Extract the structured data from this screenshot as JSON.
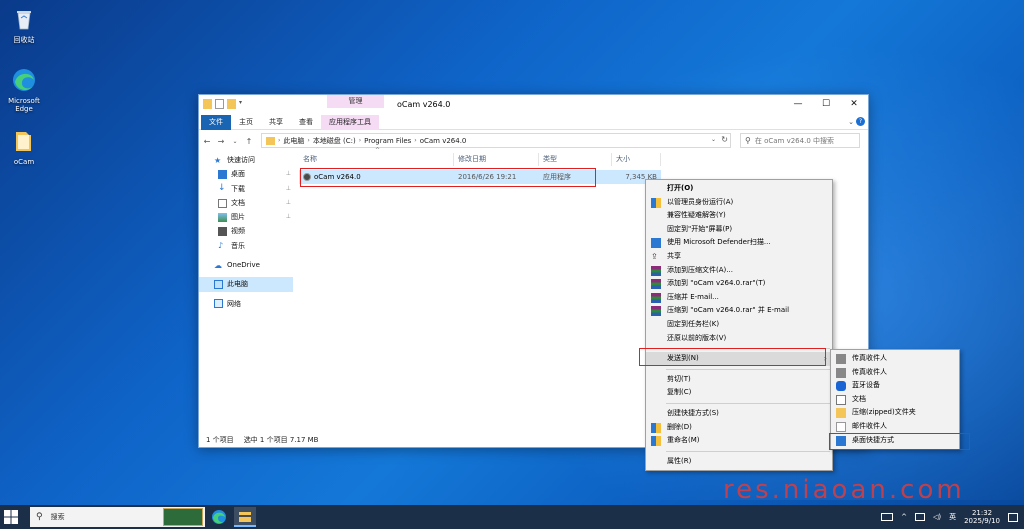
{
  "desktop": {
    "icons": [
      {
        "label": "回收站",
        "icon": "recycle-bin-icon"
      },
      {
        "label": "Microsoft Edge",
        "icon": "edge-icon"
      },
      {
        "label": "oCam",
        "icon": "folder-icon"
      }
    ]
  },
  "window": {
    "title": "oCam v264.0",
    "contextual_tab_group": "管理",
    "controls": {
      "minimize": "—",
      "maximize": "☐",
      "close": "✕"
    },
    "ribbon_tabs": [
      "文件",
      "主页",
      "共享",
      "查看",
      "应用程序工具"
    ],
    "ribbon_collapse": "⌄",
    "help": "?",
    "address": {
      "segments": [
        "此电脑",
        "本地磁盘 (C:)",
        "Program Files",
        "oCam v264.0"
      ],
      "separator": "›"
    },
    "search_placeholder": "在 oCam v264.0 中搜索",
    "nav_buttons": {
      "back": "←",
      "forward": "→",
      "dropdown": "⌄",
      "up": "↑"
    },
    "nav": [
      {
        "label": "快速访问",
        "icon": "star-icon",
        "pinned": false
      },
      {
        "label": "桌面",
        "icon": "desktop-icon",
        "pinned": true
      },
      {
        "label": "下载",
        "icon": "download-icon",
        "pinned": true
      },
      {
        "label": "文档",
        "icon": "document-icon",
        "pinned": true
      },
      {
        "label": "图片",
        "icon": "picture-icon",
        "pinned": true
      },
      {
        "label": "视频",
        "icon": "video-icon",
        "pinned": false
      },
      {
        "label": "音乐",
        "icon": "music-icon",
        "pinned": false
      },
      {
        "label": "OneDrive",
        "icon": "cloud-icon",
        "pinned": false
      },
      {
        "label": "此电脑",
        "icon": "computer-icon",
        "pinned": false,
        "selected": true
      },
      {
        "label": "网络",
        "icon": "network-icon",
        "pinned": false
      }
    ],
    "pin_glyph": "📌",
    "columns": [
      "名称",
      "修改日期",
      "类型",
      "大小"
    ],
    "files": [
      {
        "name": "oCam v264.0",
        "modified": "2016/6/26 19:21",
        "type": "应用程序",
        "size": "7,345 KB"
      }
    ],
    "status": {
      "count": "1 个项目",
      "selected": "选中 1 个项目  7.17 MB"
    }
  },
  "context_menu": {
    "items": [
      {
        "label": "打开(O)",
        "bold": true
      },
      {
        "label": "以管理员身份运行(A)",
        "icon": "shield-icon"
      },
      {
        "label": "兼容性疑难解答(Y)"
      },
      {
        "label": "固定到\"开始\"屏幕(P)"
      },
      {
        "label": "使用 Microsoft Defender扫描...",
        "icon": "defender-icon"
      },
      {
        "label": "共享",
        "icon": "share-icon"
      },
      {
        "label": "添加到压缩文件(A)...",
        "icon": "winrar-icon"
      },
      {
        "label": "添加到 \"oCam v264.0.rar\"(T)",
        "icon": "winrar-icon"
      },
      {
        "label": "压缩并 E-mail...",
        "icon": "winrar-icon"
      },
      {
        "label": "压缩到 \"oCam v264.0.rar\" 并 E-mail",
        "icon": "winrar-icon"
      },
      {
        "label": "固定到任务栏(K)"
      },
      {
        "label": "还原以前的版本(V)"
      },
      {
        "sep": true
      },
      {
        "label": "发送到(N)",
        "submenu": true,
        "highlight": true
      },
      {
        "sep": true
      },
      {
        "label": "剪切(T)"
      },
      {
        "label": "复制(C)"
      },
      {
        "sep": true
      },
      {
        "label": "创建快捷方式(S)"
      },
      {
        "label": "删除(D)",
        "icon": "shield-icon"
      },
      {
        "label": "重命名(M)",
        "icon": "shield-icon"
      },
      {
        "sep": true
      },
      {
        "label": "属性(R)"
      }
    ]
  },
  "sendto_menu": {
    "items": [
      {
        "label": "传真收件人",
        "icon": "fax-icon"
      },
      {
        "label": "传真收件人",
        "icon": "fax-icon"
      },
      {
        "label": "蓝牙设备",
        "icon": "bluetooth-icon"
      },
      {
        "label": "文档",
        "icon": "document-icon"
      },
      {
        "label": "压缩(zipped)文件夹",
        "icon": "zip-folder-icon"
      },
      {
        "label": "邮件收件人",
        "icon": "mail-icon"
      },
      {
        "label": "桌面快捷方式",
        "icon": "desktop-icon"
      }
    ]
  },
  "taskbar": {
    "search_label": "搜索",
    "ime": "英",
    "time": "21:32",
    "date": "2025/9/10"
  },
  "watermark": "res.niaoan.com",
  "colors": {
    "accent": "#1a64b4",
    "selection": "#cce8ff",
    "highlight_box": "#e02020",
    "contextual_tab": "#f5dcf4"
  }
}
